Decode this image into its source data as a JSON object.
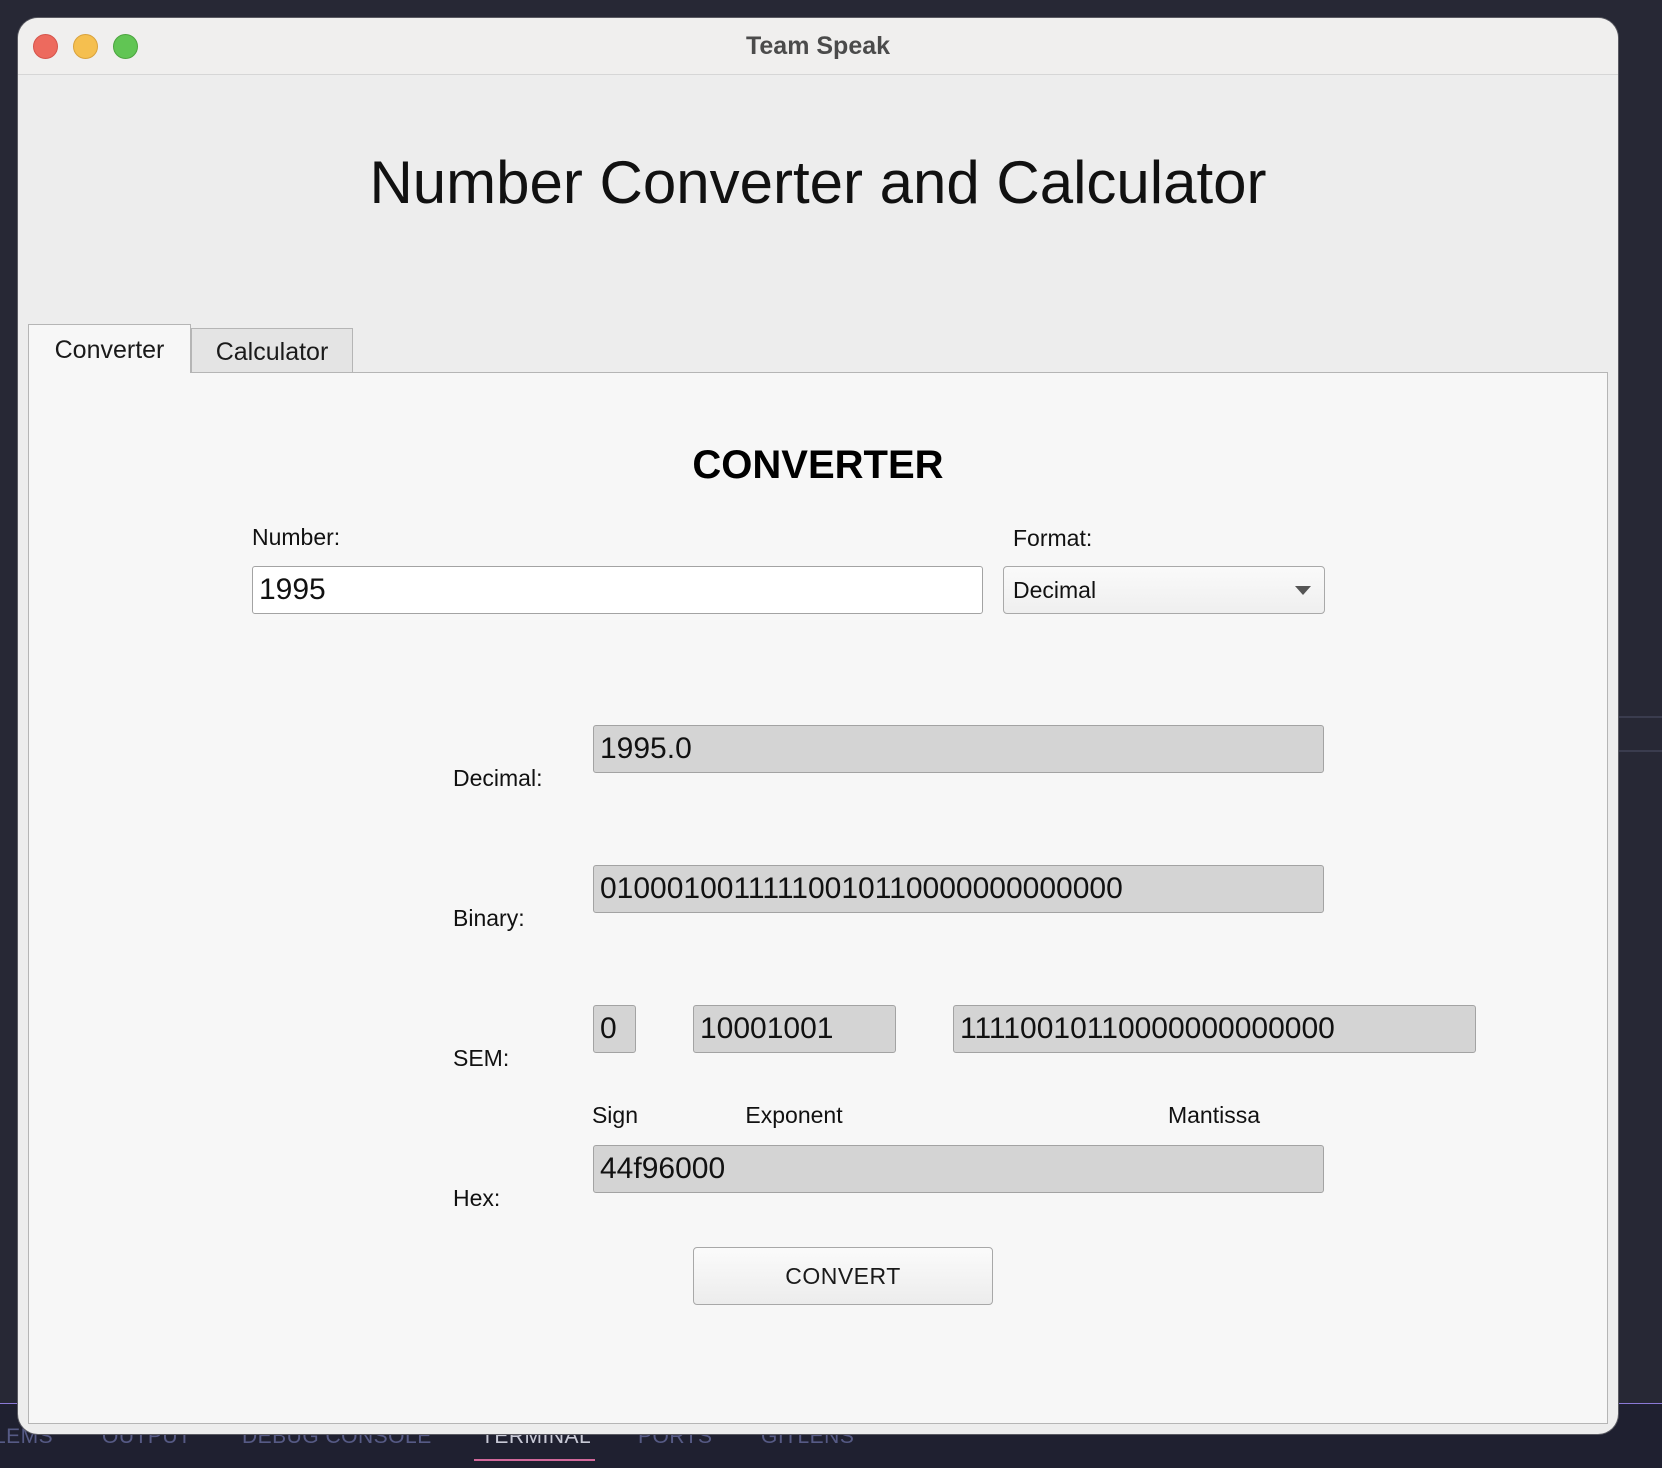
{
  "window": {
    "title": "Team Speak"
  },
  "app": {
    "title": "Number Converter and Calculator"
  },
  "tabs": [
    {
      "label": "Converter",
      "selected": true
    },
    {
      "label": "Calculator",
      "selected": false
    }
  ],
  "converter": {
    "heading": "CONVERTER",
    "number_label": "Number:",
    "number_value": "1995",
    "format_label": "Format:",
    "format_selected": "Decimal",
    "decimal_label": "Decimal:",
    "decimal_value": "1995.0",
    "binary_label": "Binary:",
    "binary_value": "01000100111110010110000000000000",
    "sem_label": "SEM:",
    "sign_value": "0",
    "exponent_value": "10001001",
    "mantissa_value": "11110010110000000000000",
    "sign_label": "Sign",
    "exponent_label": "Exponent",
    "mantissa_label": "Mantissa",
    "hex_label": "Hex:",
    "hex_value": "44f96000",
    "convert_label": "CONVERT"
  },
  "ide_panel": {
    "tabs": [
      "LEMS",
      "OUTPUT",
      "DEBUG CONSOLE",
      "TERMINAL",
      "PORTS",
      "GITLENS"
    ],
    "active": "TERMINAL"
  },
  "colors": {
    "readonly_field": "#d4d4d4",
    "panel_bg": "#f7f7f7",
    "window_bg": "#ededed",
    "ide_bg": "#272835",
    "ide_accent": "#d1689a"
  }
}
